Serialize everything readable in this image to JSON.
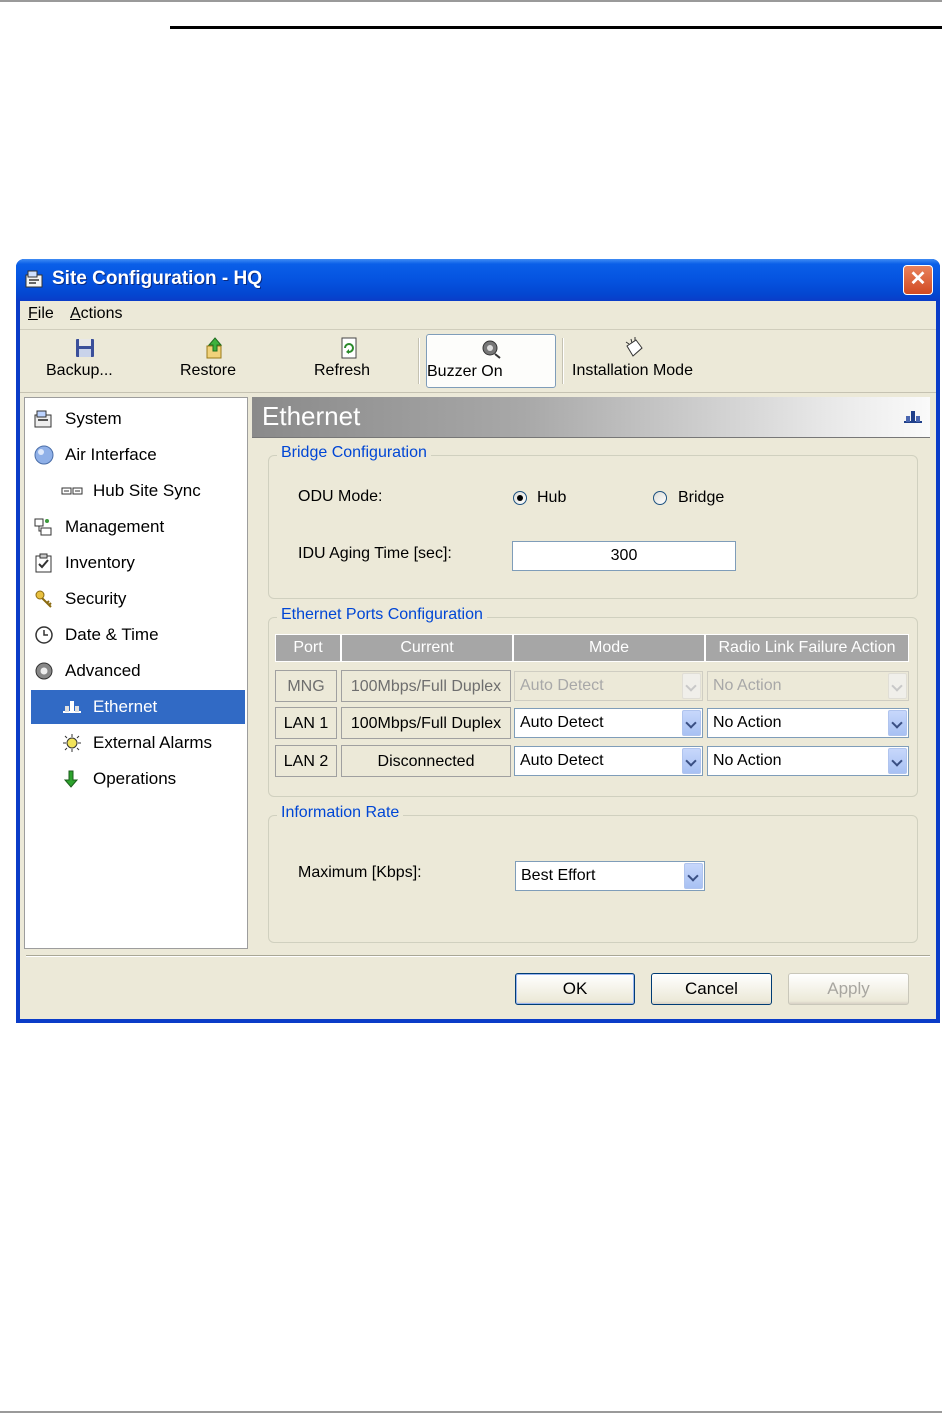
{
  "window": {
    "title": "Site Configuration - HQ",
    "close_glyph": "✕"
  },
  "menu": {
    "file_key": "F",
    "file_rest": "ile",
    "actions_key": "A",
    "actions_rest": "ctions"
  },
  "toolbar": {
    "backup": "Backup...",
    "restore": "Restore",
    "refresh": "Refresh",
    "buzzer": "Buzzer On",
    "installation": "Installation Mode"
  },
  "sidebar": {
    "items": [
      {
        "label": "System",
        "icon": "system-icon"
      },
      {
        "label": "Air Interface",
        "icon": "air-interface-icon"
      },
      {
        "label": "Hub Site Sync",
        "icon": "hub-sync-icon"
      },
      {
        "label": "Management",
        "icon": "management-icon"
      },
      {
        "label": "Inventory",
        "icon": "inventory-icon"
      },
      {
        "label": "Security",
        "icon": "security-icon"
      },
      {
        "label": "Date & Time",
        "icon": "clock-icon"
      },
      {
        "label": "Advanced",
        "icon": "advanced-icon"
      },
      {
        "label": "Ethernet",
        "icon": "ethernet-icon",
        "selected": true
      },
      {
        "label": "External Alarms",
        "icon": "external-alarms-icon"
      },
      {
        "label": "Operations",
        "icon": "operations-icon"
      }
    ]
  },
  "panel": {
    "title": "Ethernet"
  },
  "bridge": {
    "group_title": "Bridge Configuration",
    "odu_mode_label": "ODU Mode:",
    "hub_label": "Hub",
    "bridge_label": "Bridge",
    "selected": "Hub",
    "aging_label": "IDU Aging Time [sec]:",
    "aging_value": "300"
  },
  "ports": {
    "group_title": "Ethernet Ports Configuration",
    "headers": [
      "Port",
      "Current",
      "Mode",
      "Radio Link Failure Action"
    ],
    "rows": [
      {
        "port": "MNG",
        "current": "100Mbps/Full Duplex",
        "mode": "Auto Detect",
        "action": "No Action",
        "enabled": false
      },
      {
        "port": "LAN 1",
        "current": "100Mbps/Full Duplex",
        "mode": "Auto Detect",
        "action": "No Action",
        "enabled": true
      },
      {
        "port": "LAN 2",
        "current": "Disconnected",
        "mode": "Auto Detect",
        "action": "No Action",
        "enabled": true
      }
    ]
  },
  "rate": {
    "group_title": "Information Rate",
    "max_label": "Maximum [Kbps]:",
    "max_value": "Best Effort"
  },
  "buttons": {
    "ok": "OK",
    "cancel": "Cancel",
    "apply": "Apply"
  },
  "colors": {
    "titlebar": "#0553e0",
    "selection": "#316ac5",
    "group_title": "#0046d5",
    "dialog_bg": "#ece9d8"
  }
}
